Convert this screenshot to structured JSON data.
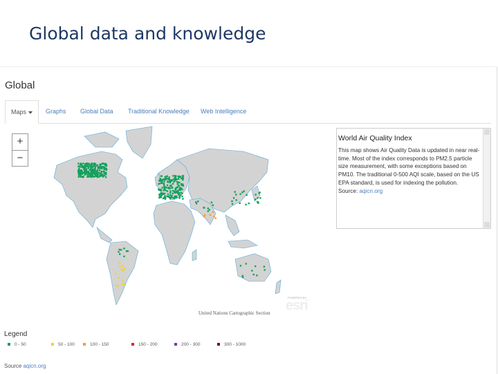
{
  "slide": {
    "title": "Global data and knowledge"
  },
  "panel": {
    "title": "Global"
  },
  "tabs": [
    {
      "label": "Maps",
      "active": true
    },
    {
      "label": "Graphs"
    },
    {
      "label": "Global Data"
    },
    {
      "label": "Traditional Knowledge"
    },
    {
      "label": "Web Intelligence"
    }
  ],
  "zoom": {
    "in": "+",
    "out": "−"
  },
  "map": {
    "credit": "United Nations Cartographic Section",
    "logo": "esri",
    "logo_small": "POWERED BY"
  },
  "info": {
    "title": "World Air Quality Index",
    "body": "This map shows Air Quality Data is updated in near real-time. Most of the index corresponds to PM2.5 particle size measurement, with some exceptions based on PM10. The traditional 0-500 AQI scale, based on the US EPA standard, is used for indexing the pollution.",
    "source_label": "Source: ",
    "source_link": "aqicn.org"
  },
  "legend": {
    "title": "Legend",
    "items": [
      {
        "label": "0 - 50",
        "color": "#16a05d"
      },
      {
        "label": "50 - 100",
        "color": "#f2d22e"
      },
      {
        "label": "100 - 150",
        "color": "#f39c33"
      },
      {
        "label": "150 - 200",
        "color": "#d8262f"
      },
      {
        "label": "200 - 300",
        "color": "#7b3a96"
      },
      {
        "label": "300 - 1000",
        "color": "#7e0023"
      }
    ]
  },
  "source": {
    "label": "Source ",
    "link": "aqicn.org"
  },
  "colors": {
    "land": "#d3d3d3",
    "water": "#ffffff",
    "coast": "#5aa9d6"
  }
}
